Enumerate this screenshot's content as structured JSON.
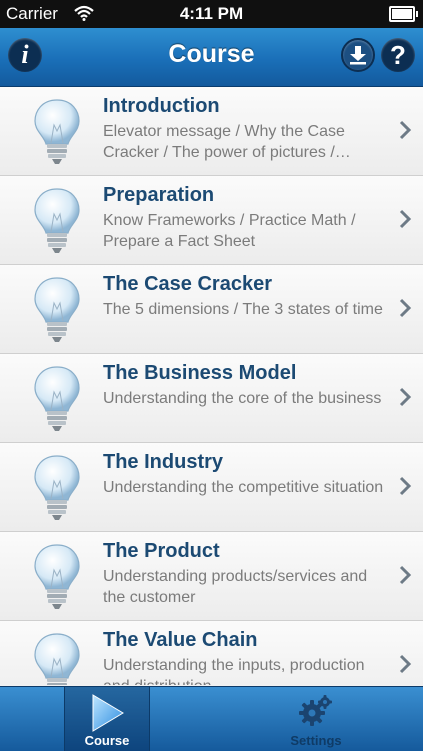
{
  "status_bar": {
    "carrier": "Carrier",
    "time": "4:11 PM"
  },
  "nav": {
    "title": "Course",
    "info_icon": "info-icon",
    "download_icon": "download-icon",
    "help_icon": "help-icon"
  },
  "list": {
    "items": [
      {
        "title": "Introduction",
        "subtitle": "Elevator message / Why the Case Cracker / The power of pictures /…"
      },
      {
        "title": "Preparation",
        "subtitle": "Know Frameworks / Practice Math / Prepare a Fact Sheet"
      },
      {
        "title": "The Case Cracker",
        "subtitle": "The 5 dimensions / The 3 states of time"
      },
      {
        "title": "The Business Model",
        "subtitle": "Understanding the core of the business"
      },
      {
        "title": "The Industry",
        "subtitle": "Understanding the competitive situation"
      },
      {
        "title": "The Product",
        "subtitle": "Understanding products/services and the customer"
      },
      {
        "title": "The Value Chain",
        "subtitle": "Understanding the inputs, production and distribution"
      }
    ]
  },
  "tabbar": {
    "tabs": [
      {
        "label": "Course",
        "icon": "play-icon",
        "selected": true
      },
      {
        "label": "Settings",
        "icon": "gear-icon",
        "selected": false
      }
    ]
  },
  "colors": {
    "nav_blue": "#1a6fb8",
    "title_blue": "#1c4a73",
    "subtitle_gray": "#7b7b7b"
  }
}
